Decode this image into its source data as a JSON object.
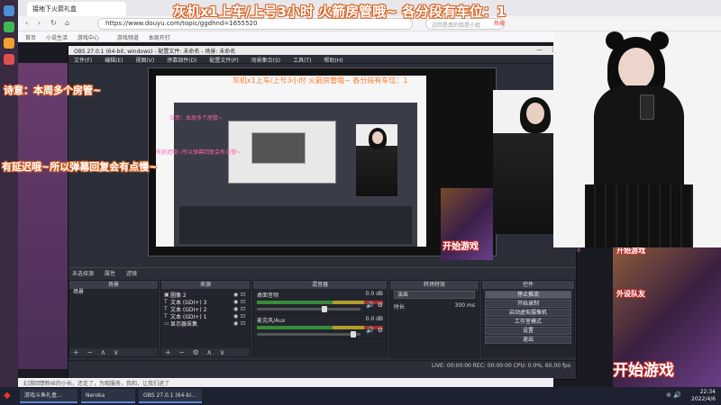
{
  "colors": {
    "accent": "#d86020",
    "obs_bg": "#2b2e38",
    "pink": "#ff5fb0",
    "taskbar": "#1e2230"
  },
  "banner": "灰机x1上车/上号3小时   火箭房管哦~   各分段有车位：1",
  "browser": {
    "tab_title": "接地下火箭礼盒",
    "url": "https://www.douyu.com/topic/ggdhnd=1655520",
    "search_placeholder": "这回是真的我是小姐",
    "hot_label": "热搜",
    "bookmarks": [
      "首页",
      "小说生活",
      "游戏中心",
      "",
      "游戏频道",
      "本周开打"
    ]
  },
  "comments": {
    "left1": "诗意：本周多个房管~",
    "left2": "有延迟哦~所以弹幕回复会有点慢~"
  },
  "obs": {
    "title": "OBS 27.0.1 (64-bit, windows) - 配置文件: 未命名 - 场景: 未命名",
    "menu": [
      "文件(F)",
      "编辑(E)",
      "视图(V)",
      "停靠部件(D)",
      "配置文件(P)",
      "场景集合(S)",
      "工具(T)",
      "帮助(H)"
    ],
    "preview": {
      "inner_banner": "灰机x1上车/上号3小时   火箭房管哦~   各分段有车位：1",
      "inner_label_1": "诗意：本周多个房管~",
      "inner_label_2": "有延迟哦~所以弹幕回复会有点慢~"
    },
    "source_bar": [
      "未选择源",
      "属性",
      "滤镜"
    ],
    "docks": {
      "scenes": {
        "title": "场景",
        "items": [
          "场景"
        ]
      },
      "sources": {
        "title": "来源",
        "items": [
          {
            "icon": "▣",
            "label": "圖像 2"
          },
          {
            "icon": "T",
            "label": "文本 (GDI+) 3"
          },
          {
            "icon": "T",
            "label": "文本 (GDI+) 2"
          },
          {
            "icon": "T",
            "label": "文本 (GDI+) 1"
          },
          {
            "icon": "▭",
            "label": "显示器采集"
          }
        ]
      },
      "mixer": {
        "title": "混音器",
        "channels": [
          {
            "name": "桌面音频",
            "db": "0.0 dB",
            "level": 0.66
          },
          {
            "name": "麦克风/Aux",
            "db": "0.0 dB",
            "level": 0.95
          }
        ]
      },
      "transitions": {
        "title": "转场特效",
        "type": "淡出",
        "duration_label": "时长",
        "duration": "300 ms"
      },
      "controls": {
        "title": "控件",
        "buttons": [
          "停止推流",
          "开始录制",
          "启动虚拟摄像机",
          "工作室模式",
          "设置",
          "退出"
        ]
      }
    },
    "status": "LIVE: 00:00:00   REC: 00:00:00   CPU: 0.0%, 60.00 fps"
  },
  "game_text": {
    "mid": "开始游戏",
    "right": "开始游戏",
    "right_top": "开始游戏",
    "right_small": "外设队友"
  },
  "notice": "幻游回馈粉丝的小长，还走了，为观服务，我和，让我们进了",
  "taskbar": {
    "apps": [
      "游戏斗鱼礼盒...",
      "Neroka",
      "OBS 27.0.1 (64-bi..."
    ],
    "time": "22:34",
    "date": "2022/4/6"
  }
}
